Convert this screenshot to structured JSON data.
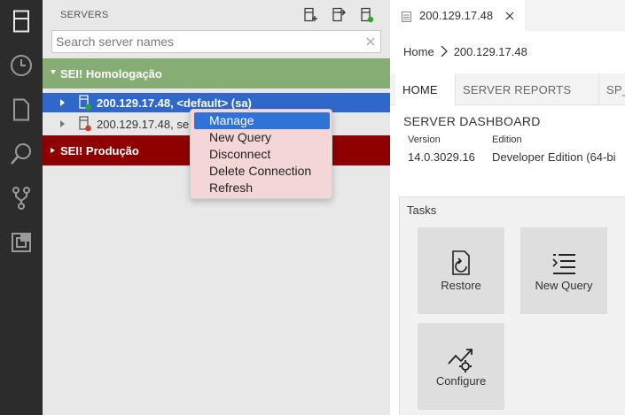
{
  "activity_bar": {
    "icons": [
      "servers-icon",
      "history-icon",
      "explorer-icon",
      "search-icon",
      "source-control-icon",
      "extensions-icon"
    ]
  },
  "sidebar": {
    "title": "SERVERS",
    "search": {
      "placeholder": "Search server names",
      "value": ""
    },
    "groups": [
      {
        "name": "SEI! Homologação",
        "color": "#86ad73",
        "expanded": true,
        "servers": [
          {
            "label": "200.129.17.48, <default> (sa)",
            "status": "connected",
            "selected": true
          },
          {
            "label": "200.129.17.48, se",
            "status": "disconnected",
            "selected": false
          }
        ]
      },
      {
        "name": "SEI! Produção",
        "color": "#8e0000",
        "expanded": false,
        "servers": []
      }
    ]
  },
  "context_menu": {
    "items": [
      "Manage",
      "New Query",
      "Disconnect",
      "Delete Connection",
      "Refresh"
    ],
    "highlighted": "Manage"
  },
  "editor": {
    "tab": {
      "label": "200.129.17.48"
    },
    "breadcrumb": {
      "home": "Home",
      "current": "200.129.17.48"
    },
    "dashboard_tabs": [
      "HOME",
      "SERVER REPORTS",
      "SP_"
    ],
    "active_tab": "HOME",
    "dashboard": {
      "title": "SERVER DASHBOARD",
      "version_label": "Version",
      "version_value": "14.0.3029.16",
      "edition_label": "Edition",
      "edition_value": "Developer Edition (64-bi"
    },
    "tasks": {
      "title": "Tasks",
      "items": [
        {
          "label": "Restore",
          "icon": "restore-icon"
        },
        {
          "label": "New Query",
          "icon": "new-query-icon"
        },
        {
          "label": "Configure",
          "icon": "configure-icon"
        }
      ]
    }
  },
  "colors": {
    "activity_bar": "#2c2c2c",
    "sidebar_bg": "#e8e8e8",
    "selection": "#3068c9",
    "menu_bg": "#f4d6d8",
    "menu_highlight": "#2f73d9",
    "status_connected": "#2aa82a",
    "status_disconnected": "#d83b1e"
  }
}
